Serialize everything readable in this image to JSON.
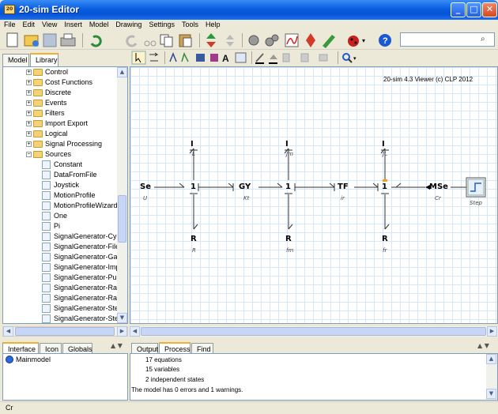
{
  "window": {
    "title": "20-sim Editor",
    "app_icon": "20-sim-logo-icon",
    "minimize": "_",
    "maximize": "□",
    "close": "✕"
  },
  "menu": [
    "File",
    "Edit",
    "View",
    "Insert",
    "Model",
    "Drawing",
    "Settings",
    "Tools",
    "Help"
  ],
  "left_tabs": [
    "Model",
    "Library"
  ],
  "left_active_tab": "Library",
  "tree": {
    "folders": [
      "Control",
      "Cost Functions",
      "Discrete",
      "Events",
      "Filters",
      "Import Export",
      "Logical",
      "Signal Processing",
      "Sources"
    ],
    "sources_items": [
      "Constant",
      "DataFromFile",
      "Joystick",
      "MotionProfile",
      "MotionProfileWizard",
      "One",
      "Pi",
      "SignalGenerator-Cyclo",
      "SignalGenerator-FileIr",
      "SignalGenerator-Gaus",
      "SignalGenerator-Impu",
      "SignalGenerator-Pulse",
      "SignalGenerator-Ramp",
      "SignalGenerator-Rand",
      "SignalGenerator-Step",
      "SignalGenerator-Step"
    ]
  },
  "canvas": {
    "viewer_note": "20-sim 4.3 Viewer (c) CLP 2012",
    "nodes": {
      "se": "Se",
      "se_param": "U",
      "j1a": "1",
      "i1": "I",
      "i1_param": "L",
      "r1": "R",
      "r1_param": "R",
      "gy": "GY",
      "gy_param": "Kt",
      "j1b": "1",
      "i2": "I",
      "i2_param": "Jm",
      "r2": "R",
      "r2_param": "fm",
      "tf": "TF",
      "tf_param": "ir",
      "j1c": "1",
      "i3": "I",
      "i3_param": "JL",
      "r3": "R",
      "r3_param": "fr",
      "mse": "MSe",
      "mse_param": "Cr",
      "step": "Step"
    }
  },
  "bottom_left_tabs": [
    "Interface",
    "Icon",
    "Globals"
  ],
  "model_tree_root": "Mainmodel",
  "bottom_right_tabs": [
    "Output",
    "Process",
    "Find"
  ],
  "bottom_right_active": "Process",
  "output_lines": [
    "17 equations",
    "15 variables",
    "2 independent states",
    "The model has 0 errors and 1 warnings."
  ],
  "status": "Cr",
  "colors": {
    "title_bar": "#0a5fe0",
    "grid": "#d7e7f7",
    "tab_highlight": "#f0b030",
    "causal_marker": "#f0a020"
  }
}
